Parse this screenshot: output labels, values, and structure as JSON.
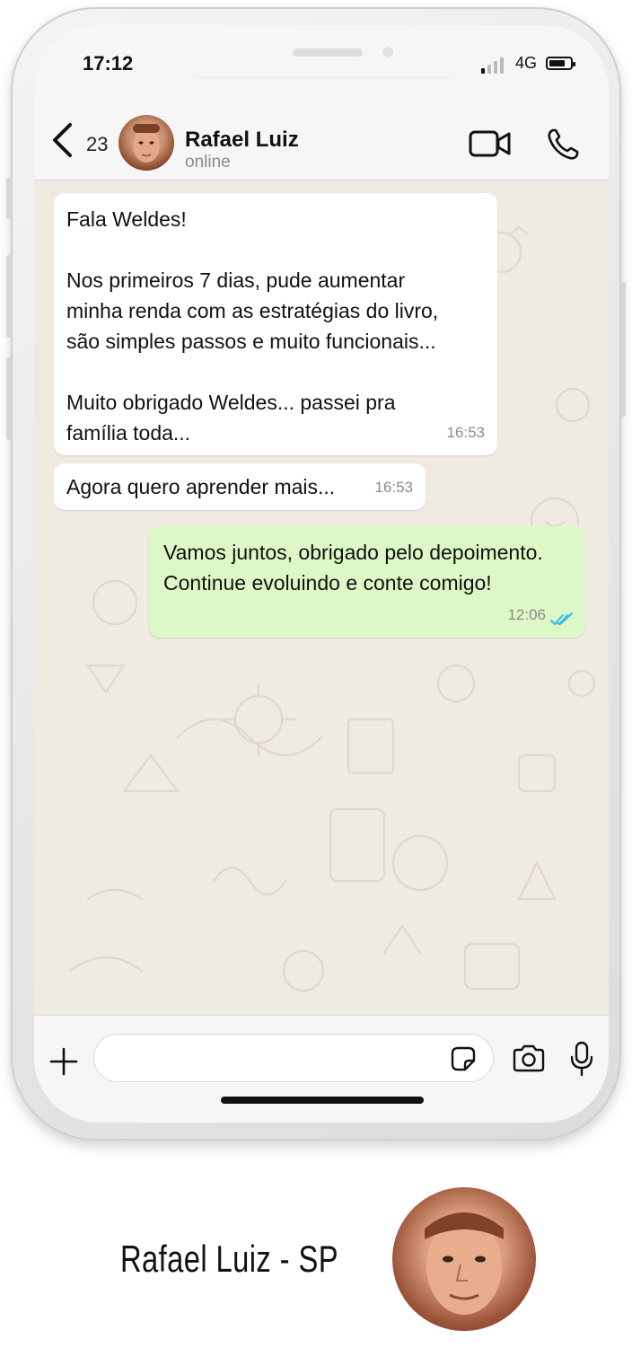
{
  "status_bar": {
    "time": "17:12",
    "network": "4G"
  },
  "header": {
    "back_count": "23",
    "contact_name": "Rafael Luiz",
    "contact_status": "online",
    "icons": [
      "chevron-left-icon",
      "video-call-icon",
      "phone-icon"
    ]
  },
  "messages": [
    {
      "direction": "incoming",
      "text": "Fala Weldes!\n\nNos primeiros 7 dias, pude aumentar\nminha renda  com as estratégias do livro,\nsão simples passos e muito funcionais...\n\nMuito obrigado Weldes... passei pra\nfamília toda...",
      "time": "16:53"
    },
    {
      "direction": "incoming",
      "text": "Agora quero aprender mais...",
      "time": "16:53"
    },
    {
      "direction": "outgoing",
      "text": "Vamos juntos, obrigado pelo depoimento.\nContinue evoluindo e conte comigo!",
      "time": "12:06",
      "read": true
    }
  ],
  "input_bar": {
    "placeholder": "",
    "icons": [
      "plus-icon",
      "sticker-icon",
      "camera-icon",
      "microphone-icon"
    ]
  },
  "caption": {
    "text": "Rafael Luiz - SP"
  },
  "colors": {
    "chat_bg": "#efeae2",
    "outgoing_bubble": "#dcf8c6",
    "incoming_bubble": "#ffffff",
    "read_ticks": "#34b7f1"
  }
}
